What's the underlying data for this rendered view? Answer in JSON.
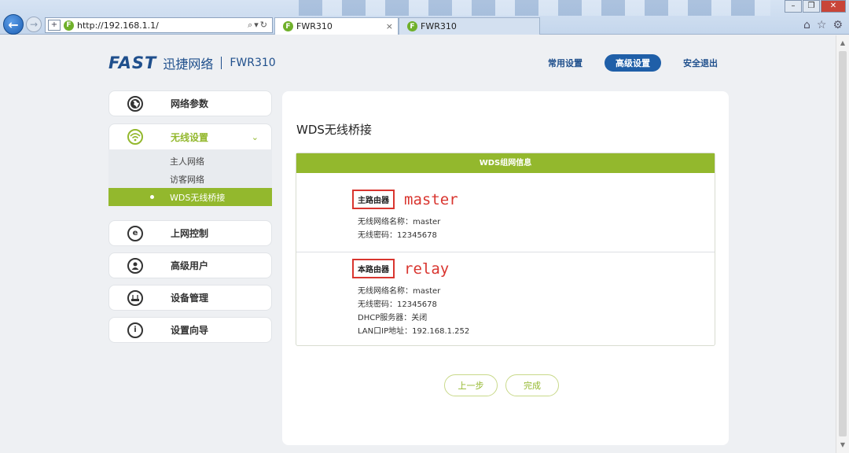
{
  "browser": {
    "url": "http://192.168.1.1/",
    "tabs": [
      {
        "label": "FWR310",
        "active": true,
        "close": "×"
      },
      {
        "label": "FWR310",
        "active": false
      }
    ],
    "icons": [
      "back-arrow-icon",
      "forward-arrow-icon",
      "home-icon",
      "star-icon",
      "gear-icon"
    ]
  },
  "header": {
    "brand": "FAST",
    "brand_cn": "迅捷网络",
    "model": "FWR310",
    "nav": [
      {
        "label": "常用设置",
        "active": false
      },
      {
        "label": "高级设置",
        "active": true
      },
      {
        "label": "安全退出",
        "active": false
      }
    ]
  },
  "sidebar": {
    "items": [
      {
        "label": "网络参数",
        "icon": "globe-icon"
      },
      {
        "label": "无线设置",
        "icon": "wifi-icon",
        "expanded": true
      },
      {
        "label": "上网控制",
        "icon": "ie-icon"
      },
      {
        "label": "高级用户",
        "icon": "user-icon"
      },
      {
        "label": "设备管理",
        "icon": "router-icon"
      },
      {
        "label": "设置向导",
        "icon": "info-icon"
      }
    ],
    "submenu": [
      {
        "label": "主人网络",
        "active": false
      },
      {
        "label": "访客网络",
        "active": false
      },
      {
        "label": "WDS无线桥接",
        "active": true
      }
    ]
  },
  "main": {
    "title": "WDS无线桥接",
    "panel_title": "WDS组网信息",
    "master": {
      "tag": "主路由器",
      "annotation": "master",
      "lines": [
        "无线网络名称：master",
        "无线密码：12345678"
      ]
    },
    "relay": {
      "tag": "本路由器",
      "annotation": "relay",
      "lines": [
        "无线网络名称：master",
        "无线密码：12345678",
        "DHCP服务器：关闭",
        "LAN口IP地址：192.168.1.252"
      ]
    },
    "buttons": {
      "prev": "上一步",
      "done": "完成"
    }
  },
  "colors": {
    "accent_green": "#93b82d",
    "brand_blue": "#1f4f8c",
    "highlight_red": "#d9352f"
  }
}
